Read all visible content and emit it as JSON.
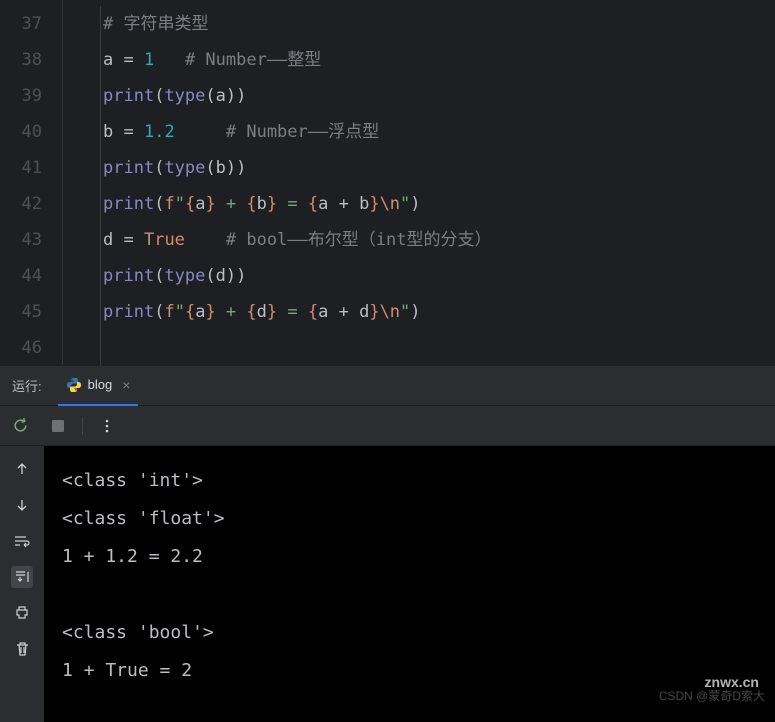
{
  "editor": {
    "lines": [
      {
        "num": "37",
        "tokens": [
          {
            "cls": "tok-comment",
            "t": "# 字符串类型"
          }
        ]
      },
      {
        "num": "38",
        "tokens": [
          {
            "cls": "tok-var",
            "t": "a"
          },
          {
            "cls": "tok-op",
            "t": " = "
          },
          {
            "cls": "tok-num",
            "t": "1"
          },
          {
            "cls": "",
            "t": "   "
          },
          {
            "cls": "tok-comment",
            "t": "# Number——整型"
          }
        ]
      },
      {
        "num": "39",
        "tokens": [
          {
            "cls": "tok-builtin",
            "t": "print"
          },
          {
            "cls": "tok-paren",
            "t": "("
          },
          {
            "cls": "tok-builtin",
            "t": "type"
          },
          {
            "cls": "tok-paren",
            "t": "("
          },
          {
            "cls": "tok-var",
            "t": "a"
          },
          {
            "cls": "tok-paren",
            "t": "))"
          }
        ]
      },
      {
        "num": "40",
        "tokens": [
          {
            "cls": "tok-var",
            "t": "b"
          },
          {
            "cls": "tok-op",
            "t": " = "
          },
          {
            "cls": "tok-num",
            "t": "1.2"
          },
          {
            "cls": "",
            "t": "     "
          },
          {
            "cls": "tok-comment",
            "t": "# Number——浮点型"
          }
        ]
      },
      {
        "num": "41",
        "tokens": [
          {
            "cls": "tok-builtin",
            "t": "print"
          },
          {
            "cls": "tok-paren",
            "t": "("
          },
          {
            "cls": "tok-builtin",
            "t": "type"
          },
          {
            "cls": "tok-paren",
            "t": "("
          },
          {
            "cls": "tok-var",
            "t": "b"
          },
          {
            "cls": "tok-paren",
            "t": "))"
          }
        ]
      },
      {
        "num": "42",
        "tokens": [
          {
            "cls": "tok-builtin",
            "t": "print"
          },
          {
            "cls": "tok-paren",
            "t": "("
          },
          {
            "cls": "tok-keyword",
            "t": "f"
          },
          {
            "cls": "tok-str",
            "t": "\""
          },
          {
            "cls": "tok-fstring-brace",
            "t": "{"
          },
          {
            "cls": "tok-fstring-var",
            "t": "a"
          },
          {
            "cls": "tok-fstring-brace",
            "t": "}"
          },
          {
            "cls": "tok-str",
            "t": " + "
          },
          {
            "cls": "tok-fstring-brace",
            "t": "{"
          },
          {
            "cls": "tok-fstring-var",
            "t": "b"
          },
          {
            "cls": "tok-fstring-brace",
            "t": "}"
          },
          {
            "cls": "tok-str",
            "t": " = "
          },
          {
            "cls": "tok-fstring-brace",
            "t": "{"
          },
          {
            "cls": "tok-fstring-var",
            "t": "a + b"
          },
          {
            "cls": "tok-fstring-brace",
            "t": "}"
          },
          {
            "cls": "tok-esc",
            "t": "\\n"
          },
          {
            "cls": "tok-str",
            "t": "\""
          },
          {
            "cls": "tok-paren",
            "t": ")"
          }
        ]
      },
      {
        "num": "43",
        "tokens": [
          {
            "cls": "tok-var",
            "t": "d"
          },
          {
            "cls": "tok-op",
            "t": " = "
          },
          {
            "cls": "tok-keyword",
            "t": "True"
          },
          {
            "cls": "",
            "t": "    "
          },
          {
            "cls": "tok-comment",
            "t": "# bool——布尔型（int型的分支）"
          }
        ]
      },
      {
        "num": "44",
        "tokens": [
          {
            "cls": "tok-builtin",
            "t": "print"
          },
          {
            "cls": "tok-paren",
            "t": "("
          },
          {
            "cls": "tok-builtin",
            "t": "type"
          },
          {
            "cls": "tok-paren",
            "t": "("
          },
          {
            "cls": "tok-var",
            "t": "d"
          },
          {
            "cls": "tok-paren",
            "t": "))"
          }
        ]
      },
      {
        "num": "45",
        "tokens": [
          {
            "cls": "tok-builtin",
            "t": "print"
          },
          {
            "cls": "tok-paren",
            "t": "("
          },
          {
            "cls": "tok-keyword",
            "t": "f"
          },
          {
            "cls": "tok-str",
            "t": "\""
          },
          {
            "cls": "tok-fstring-brace",
            "t": "{"
          },
          {
            "cls": "tok-fstring-var",
            "t": "a"
          },
          {
            "cls": "tok-fstring-brace",
            "t": "}"
          },
          {
            "cls": "tok-str",
            "t": " + "
          },
          {
            "cls": "tok-fstring-brace",
            "t": "{"
          },
          {
            "cls": "tok-fstring-var",
            "t": "d"
          },
          {
            "cls": "tok-fstring-brace",
            "t": "}"
          },
          {
            "cls": "tok-str",
            "t": " = "
          },
          {
            "cls": "tok-fstring-brace",
            "t": "{"
          },
          {
            "cls": "tok-fstring-var",
            "t": "a + d"
          },
          {
            "cls": "tok-fstring-brace",
            "t": "}"
          },
          {
            "cls": "tok-esc",
            "t": "\\n"
          },
          {
            "cls": "tok-str",
            "t": "\""
          },
          {
            "cls": "tok-paren",
            "t": ")"
          }
        ]
      },
      {
        "num": "46",
        "tokens": []
      }
    ]
  },
  "run_panel": {
    "run_label": "运行:",
    "tab_name": "blog"
  },
  "output": {
    "lines": [
      "<class 'int'>",
      "<class 'float'>",
      "1 + 1.2 = 2.2",
      "",
      "<class 'bool'>",
      "1 + True = 2"
    ]
  },
  "watermark": {
    "main": "znwx.cn",
    "sub": "CSDN @蒙奇D索大"
  }
}
